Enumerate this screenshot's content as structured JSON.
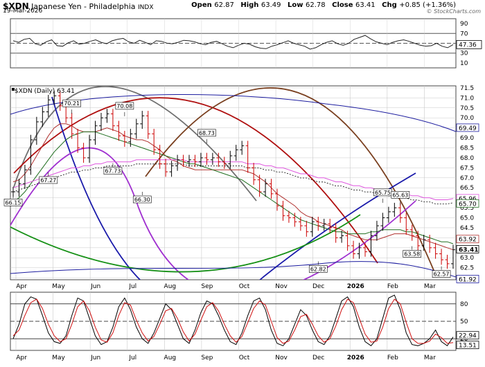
{
  "header": {
    "symbol": "$XDN",
    "name": "Japanese Yen - Philadelphia",
    "exchange": "INDX",
    "date": "19-Mar-2026",
    "open_label": "Open",
    "open": "62.87",
    "high_label": "High",
    "high": "63.49",
    "low_label": "Low",
    "low": "62.78",
    "close_label": "Close",
    "close": "63.41",
    "chg_label": "Chg",
    "chg": "+0.85 (+1.36%)",
    "brand": "© StockCharts.com"
  },
  "colors": {
    "grid": "#c9c9c9",
    "text": "#000000",
    "up": "#000000",
    "down": "#cc0000",
    "ma_blue": "#1a1a9e",
    "ma_green": "#1f6e1f",
    "ma_red": "#b0302e",
    "ma_pink": "#dd55dd",
    "ma_black_dot": "#000000",
    "stoch_black": "#000000",
    "stoch_red": "#d01010"
  },
  "chart_data": [
    {
      "type": "line",
      "panel": "upper indicator",
      "y_ticks": [
        "90",
        "70",
        "50",
        "30",
        "10"
      ],
      "ylim": [
        0,
        100
      ],
      "reference_levels": [
        70,
        50,
        30
      ],
      "last_label": "47.36",
      "series": [
        {
          "values": [
            55,
            52,
            58,
            60,
            49,
            46,
            53,
            57,
            45,
            44,
            51,
            55,
            48,
            50,
            54,
            57,
            52,
            49,
            55,
            58,
            60,
            53,
            50,
            56,
            52,
            47,
            55,
            54,
            50,
            49,
            52,
            56,
            55,
            53,
            49,
            47,
            52,
            54,
            49,
            44,
            41,
            46,
            50,
            48,
            43,
            40,
            39,
            44,
            47,
            51,
            55,
            50,
            47,
            44,
            38,
            41,
            47,
            52,
            55,
            49,
            46,
            50,
            58,
            62,
            66,
            59,
            53,
            50,
            47,
            52,
            55,
            57,
            54,
            50,
            46,
            44,
            45,
            50,
            44,
            41,
            47.36
          ]
        }
      ]
    },
    {
      "type": "line",
      "panel": "price",
      "title": "$XDN (Daily) 63.41",
      "x_tick_labels": [
        "Apr",
        "May",
        "Jun",
        "Jul",
        "Aug",
        "Sep",
        "Oct",
        "Nov",
        "Dec",
        "2026",
        "Feb",
        "Mar"
      ],
      "y_ticks": [
        "71.5",
        "71.0",
        "70.5",
        "70.0",
        "69.5",
        "69.0",
        "68.5",
        "68.0",
        "67.5",
        "67.0",
        "66.5",
        "66.0",
        "65.5",
        "65.0",
        "64.5",
        "64.0",
        "63.5",
        "63.0",
        "62.5",
        "62.0"
      ],
      "ylim": [
        61.9,
        71.6
      ],
      "annotations": [
        "66.15",
        "67.27",
        "70.21",
        "67.73",
        "70.08",
        "66.30",
        "68.73",
        "62.82",
        "65.75",
        "65.63",
        "63.58",
        "62.57"
      ],
      "right_labels": [
        "69.49",
        "65.96",
        "65.70",
        "63.92",
        "63.41",
        "61.92"
      ],
      "series": [
        {
          "values": [
            66.3,
            66.7,
            67.4,
            68.9,
            69.8,
            70.3,
            70.9,
            71.1,
            70.6,
            70.0,
            69.2,
            68.5,
            68.0,
            68.9,
            69.6,
            70.0,
            70.2,
            69.6,
            69.1,
            68.8,
            69.2,
            69.7,
            70.1,
            69.2,
            68.4,
            67.7,
            67.3,
            67.6,
            67.9,
            67.8,
            67.9,
            67.8,
            68.0,
            67.9,
            68.0,
            67.8,
            67.7,
            68.1,
            68.4,
            68.6,
            67.5,
            66.9,
            66.3,
            66.7,
            66.2,
            65.6,
            65.1,
            65.0,
            64.8,
            64.6,
            64.3,
            64.8,
            64.6,
            64.7,
            64.5,
            64.0,
            64.1,
            63.6,
            63.2,
            63.5,
            63.3,
            64.1,
            64.6,
            65.0,
            65.3,
            65.5,
            65.0,
            64.4,
            64.1,
            63.6,
            63.9,
            63.5,
            63.2,
            62.9,
            62.7,
            63.4
          ]
        },
        {
          "values": [
            66.8,
            66.9,
            67.2,
            67.6,
            68.1,
            68.6,
            69.1,
            69.5,
            69.7,
            69.7,
            69.6,
            69.4,
            69.3,
            69.3,
            69.3,
            69.4,
            69.5,
            69.4,
            69.3,
            69.1,
            69.0,
            68.9,
            68.9,
            68.8,
            68.6,
            68.4,
            68.1,
            67.9,
            67.8,
            67.6,
            67.5,
            67.4,
            67.4,
            67.4,
            67.4,
            67.4,
            67.4,
            67.4,
            67.4,
            67.4,
            67.3,
            67.2,
            67.0,
            66.8,
            66.5,
            66.2,
            66.0,
            65.8,
            65.6,
            65.3,
            65.1,
            65.0,
            64.8,
            64.7,
            64.6,
            64.5,
            64.4,
            64.2,
            64.1,
            64.0,
            63.9,
            63.9,
            63.9,
            64.0,
            64.1,
            64.2,
            64.2,
            64.2,
            64.1,
            64.0,
            63.9,
            63.8,
            63.7,
            63.6,
            63.5,
            63.4
          ]
        },
        {
          "values": [
            65.8,
            66.0,
            66.3,
            66.7,
            67.1,
            67.5,
            67.9,
            68.3,
            68.6,
            68.9,
            69.1,
            69.2,
            69.3,
            69.3,
            69.3,
            69.2,
            69.1,
            69.0,
            68.9,
            68.8,
            68.7,
            68.6,
            68.5,
            68.4,
            68.3,
            68.2,
            68.1,
            68.0,
            67.9,
            67.8,
            67.7,
            67.7,
            67.6,
            67.5,
            67.4,
            67.3,
            67.2,
            67.1,
            67.0,
            66.9,
            66.7,
            66.5,
            66.3,
            66.1,
            65.9,
            65.7,
            65.5,
            65.3,
            65.1,
            64.9,
            64.8,
            64.7,
            64.6,
            64.5,
            64.4,
            64.3,
            64.3,
            64.2,
            64.2,
            64.2,
            64.2,
            64.3,
            64.3,
            64.4,
            64.4,
            64.4,
            64.4,
            64.3,
            64.3,
            64.2,
            64.1,
            64.0,
            63.9,
            63.8,
            63.8,
            63.7
          ]
        },
        {
          "values": [
            66.5,
            66.6,
            66.7,
            66.8,
            66.9,
            67.0,
            67.1,
            67.2,
            67.3,
            67.4,
            67.5,
            67.5,
            67.6,
            67.6,
            67.7,
            67.7,
            67.8,
            67.8,
            67.8,
            67.8,
            67.8,
            67.9,
            67.9,
            67.9,
            67.9,
            67.9,
            67.9,
            67.9,
            67.9,
            67.9,
            67.8,
            67.8,
            67.8,
            67.8,
            67.8,
            67.8,
            67.8,
            67.8,
            67.8,
            67.8,
            67.7,
            67.7,
            67.7,
            67.6,
            67.6,
            67.5,
            67.5,
            67.4,
            67.3,
            67.2,
            67.2,
            67.1,
            67.0,
            67.0,
            66.9,
            66.8,
            66.8,
            66.7,
            66.6,
            66.6,
            66.5,
            66.5,
            66.4,
            66.4,
            66.3,
            66.3,
            66.2,
            66.2,
            66.1,
            66.1,
            66.0,
            66.0,
            65.9,
            65.9,
            65.9,
            65.96
          ]
        }
      ]
    },
    {
      "type": "line",
      "panel": "lower indicator",
      "x_tick_labels": [
        "Apr",
        "May",
        "Jun",
        "Jul",
        "Aug",
        "Sep",
        "Oct",
        "Nov",
        "Dec",
        "2026",
        "Feb",
        "Mar"
      ],
      "y_ticks": [
        "80",
        "50",
        "20"
      ],
      "ylim": [
        0,
        100
      ],
      "reference_levels": [
        80,
        50,
        20
      ],
      "right_labels": [
        "22.94",
        "13.51"
      ],
      "series": [
        {
          "values": [
            20,
            45,
            80,
            92,
            88,
            60,
            30,
            15,
            12,
            25,
            60,
            90,
            85,
            55,
            25,
            10,
            15,
            40,
            75,
            90,
            70,
            40,
            20,
            12,
            30,
            55,
            80,
            70,
            45,
            20,
            12,
            35,
            65,
            85,
            80,
            60,
            35,
            15,
            10,
            30,
            60,
            85,
            90,
            70,
            35,
            12,
            8,
            20,
            45,
            70,
            60,
            35,
            15,
            10,
            25,
            55,
            85,
            92,
            75,
            40,
            15,
            8,
            20,
            55,
            90,
            95,
            70,
            30,
            10,
            8,
            12,
            20,
            35,
            15,
            8,
            22.94
          ]
        },
        {
          "values": [
            25,
            35,
            60,
            82,
            88,
            72,
            45,
            25,
            15,
            20,
            45,
            75,
            85,
            68,
            40,
            18,
            14,
            30,
            60,
            82,
            78,
            52,
            30,
            16,
            24,
            45,
            68,
            72,
            55,
            32,
            16,
            28,
            52,
            75,
            82,
            68,
            45,
            25,
            14,
            24,
            48,
            72,
            85,
            78,
            50,
            22,
            12,
            16,
            35,
            58,
            62,
            45,
            25,
            14,
            20,
            42,
            70,
            88,
            82,
            55,
            28,
            14,
            16,
            40,
            72,
            88,
            80,
            48,
            20,
            12,
            12,
            16,
            28,
            22,
            12,
            13.51
          ]
        }
      ]
    }
  ]
}
